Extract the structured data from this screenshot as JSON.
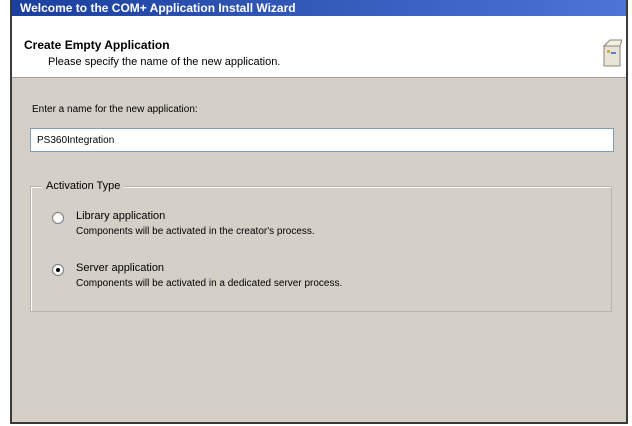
{
  "window": {
    "title": "Welcome to the COM+ Application Install Wizard"
  },
  "header": {
    "title": "Create Empty Application",
    "subtitle": "Please specify the name of the new application.",
    "icon": "wizard-box-icon"
  },
  "name_field": {
    "label": "Enter a name for the new application:",
    "value": "PS360Integration"
  },
  "activation": {
    "legend": "Activation Type",
    "options": [
      {
        "label": "Library application",
        "description": "Components will be activated in the creator's process.",
        "selected": false
      },
      {
        "label": "Server application",
        "description": "Components will be activated in a dedicated server process.",
        "selected": true
      }
    ]
  }
}
